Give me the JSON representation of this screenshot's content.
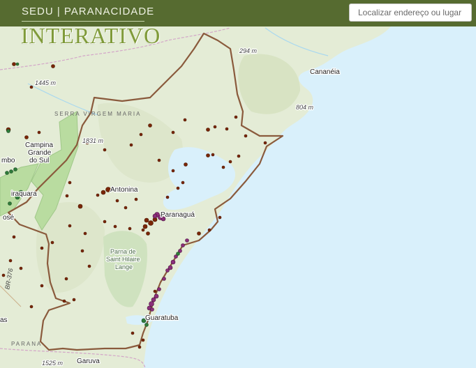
{
  "header": {
    "brand_small": "SEDU | PARANACIDADE",
    "brand_big": "INTERATIVO"
  },
  "search": {
    "placeholder": "Localizar endereço ou lugar"
  },
  "map": {
    "towns": [
      "Cananéia",
      "Campina",
      "Grande",
      "do Sul",
      "Antonina",
      "Paranaguá",
      "Guaratuba",
      "Garuva",
      "mbo",
      "iraquara",
      "osé",
      "as"
    ],
    "elevations": [
      "294 m",
      "1445 m",
      "804 m",
      "1831 m",
      "1525 m"
    ],
    "ranges": [
      "SERRA VIRGEM MARIA",
      "PARANA"
    ],
    "parks": [
      "Parna de",
      "Saint Hilaire",
      "Lange"
    ],
    "roads": [
      "BR-376"
    ],
    "colors": {
      "header": "#566b30",
      "brand_big": "#7f9a3a",
      "ocean": "#d9f0fb",
      "land": "#e4ecd6",
      "boundary": "#8a5a3c",
      "point_brown": "#7a2606",
      "point_purple": "#8b2f7a"
    }
  }
}
